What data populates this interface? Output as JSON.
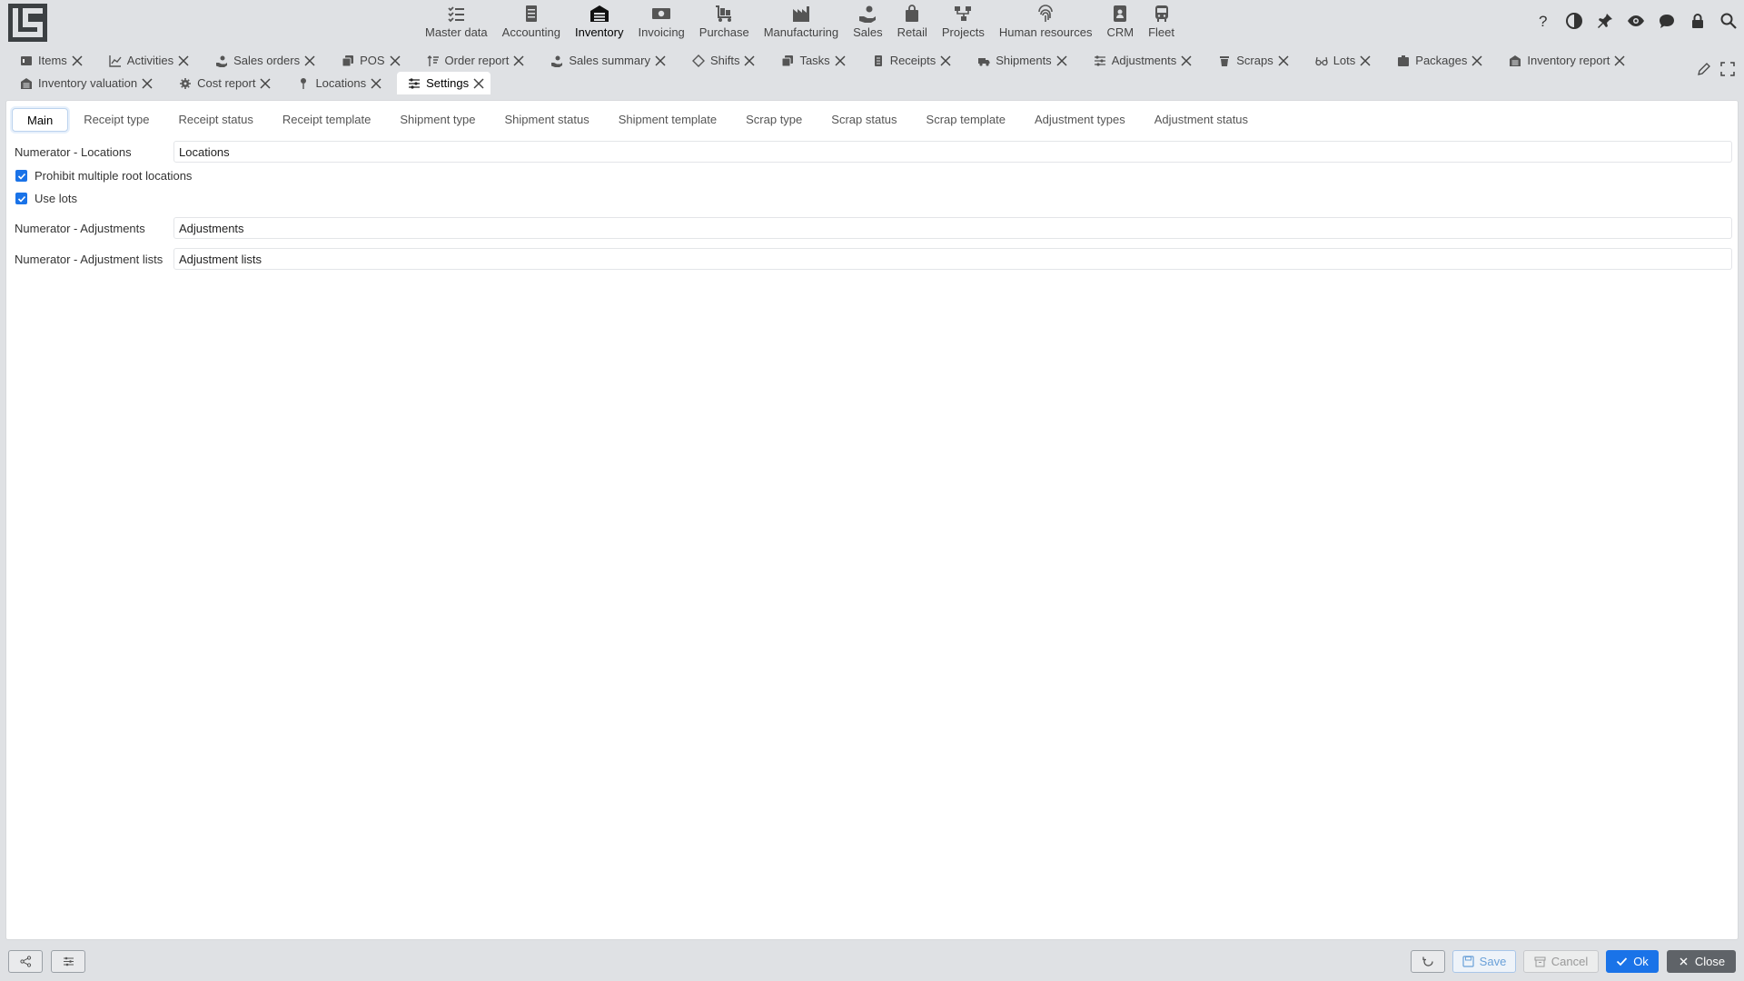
{
  "nav": {
    "modules": [
      {
        "label": "Master data",
        "icon": "list-check-icon"
      },
      {
        "label": "Accounting",
        "icon": "ledger-icon"
      },
      {
        "label": "Inventory",
        "icon": "warehouse-icon"
      },
      {
        "label": "Invoicing",
        "icon": "banknote-icon"
      },
      {
        "label": "Purchase",
        "icon": "cart-dolly-icon"
      },
      {
        "label": "Manufacturing",
        "icon": "factory-icon"
      },
      {
        "label": "Sales",
        "icon": "hand-coin-icon"
      },
      {
        "label": "Retail",
        "icon": "shopping-bag-icon"
      },
      {
        "label": "Projects",
        "icon": "project-tree-icon"
      },
      {
        "label": "Human resources",
        "icon": "fingerprint-icon"
      },
      {
        "label": "CRM",
        "icon": "contact-book-icon"
      },
      {
        "label": "Fleet",
        "icon": "bus-icon"
      }
    ],
    "active_module": "Inventory"
  },
  "tabs": {
    "row1": [
      {
        "label": "Items",
        "icon": "items-icon"
      },
      {
        "label": "Activities",
        "icon": "line-chart-icon"
      },
      {
        "label": "Sales orders",
        "icon": "hand-coin-icon"
      },
      {
        "label": "POS",
        "icon": "copy-icon"
      },
      {
        "label": "Order report",
        "icon": "sort-icon"
      },
      {
        "label": "Sales summary",
        "icon": "hand-coin-icon"
      },
      {
        "label": "Shifts",
        "icon": "diamond-icon"
      },
      {
        "label": "Tasks",
        "icon": "copy-icon"
      },
      {
        "label": "Receipts",
        "icon": "document-icon"
      },
      {
        "label": "Shipments",
        "icon": "truck-icon"
      },
      {
        "label": "Adjustments",
        "icon": "sliders-icon"
      },
      {
        "label": "Scraps",
        "icon": "trash-icon"
      },
      {
        "label": "Lots",
        "icon": "glasses-icon"
      },
      {
        "label": "Packages",
        "icon": "package-icon"
      },
      {
        "label": "Inventory report",
        "icon": "warehouse-icon"
      }
    ],
    "row2": [
      {
        "label": "Inventory valuation",
        "icon": "warehouse-icon"
      },
      {
        "label": "Cost report",
        "icon": "gear-icon"
      },
      {
        "label": "Locations",
        "icon": "pin-icon"
      },
      {
        "label": "Settings",
        "icon": "sliders-icon"
      }
    ],
    "active_tab": "Settings"
  },
  "settings": {
    "subtabs": [
      "Main",
      "Receipt type",
      "Receipt status",
      "Receipt template",
      "Shipment type",
      "Shipment status",
      "Shipment template",
      "Scrap type",
      "Scrap status",
      "Scrap template",
      "Adjustment types",
      "Adjustment status"
    ],
    "active_subtab": "Main",
    "numerator_locations": {
      "label": "Numerator - Locations",
      "value": "Locations"
    },
    "prohibit_multiple_root": {
      "label": "Prohibit multiple root locations",
      "checked": true
    },
    "use_lots": {
      "label": "Use lots",
      "checked": true
    },
    "numerator_adjustments": {
      "label": "Numerator - Adjustments",
      "value": "Adjustments"
    },
    "numerator_adjustment_lists": {
      "label": "Numerator - Adjustment lists",
      "value": "Adjustment lists"
    }
  },
  "footer": {
    "save_label": "Save",
    "cancel_label": "Cancel",
    "ok_label": "Ok",
    "close_label": "Close"
  },
  "colors": {
    "accent": "#1a73e8",
    "close_button": "#5f6368",
    "topbar_bg": "#dfe1e4"
  }
}
